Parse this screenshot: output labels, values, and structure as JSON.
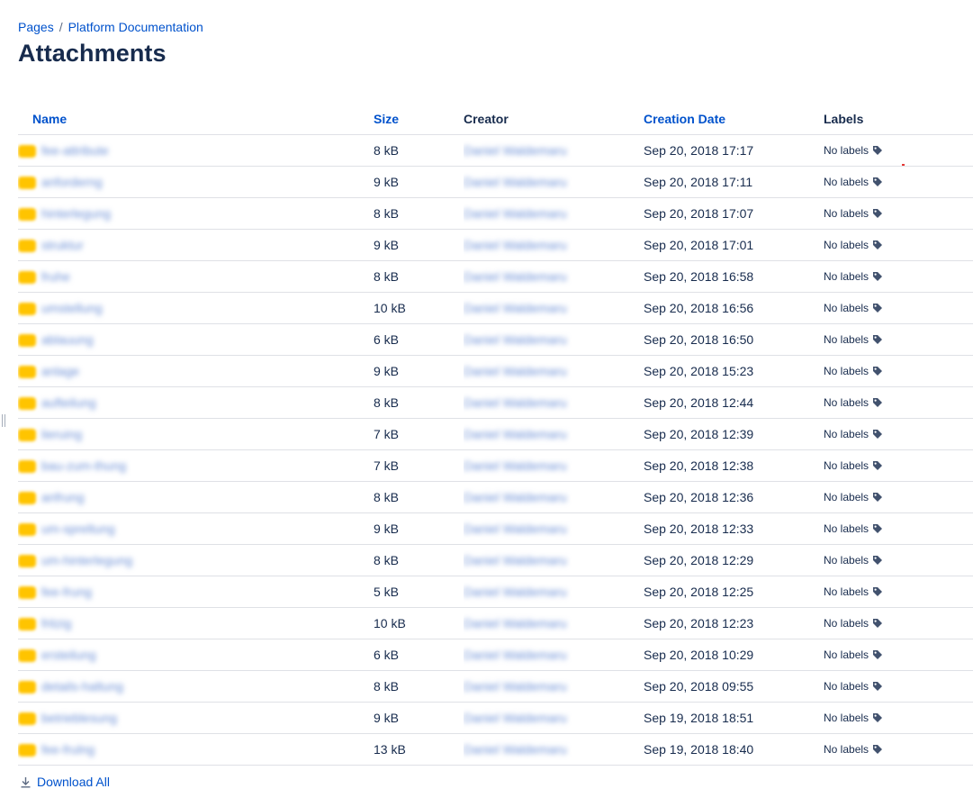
{
  "breadcrumb": {
    "items": [
      "Pages",
      "Platform Documentation"
    ],
    "separator": "/"
  },
  "page_title": "Attachments",
  "table": {
    "columns": {
      "name": "Name",
      "size": "Size",
      "creator": "Creator",
      "creation_date": "Creation Date",
      "labels": "Labels"
    },
    "rows": [
      {
        "name": "fee-attribute",
        "size": "8 kB",
        "creator": "Daniel Waldemaru",
        "date": "Sep 20, 2018 17:17",
        "labels": "No labels"
      },
      {
        "name": "anforderng",
        "size": "9 kB",
        "creator": "Daniel Waldemaru",
        "date": "Sep 20, 2018 17:11",
        "labels": "No labels"
      },
      {
        "name": "hinterlegung",
        "size": "8 kB",
        "creator": "Daniel Waldemaru",
        "date": "Sep 20, 2018 17:07",
        "labels": "No labels"
      },
      {
        "name": "struktur",
        "size": "9 kB",
        "creator": "Daniel Waldemaru",
        "date": "Sep 20, 2018 17:01",
        "labels": "No labels"
      },
      {
        "name": "fruhe",
        "size": "8 kB",
        "creator": "Daniel Waldemaru",
        "date": "Sep 20, 2018 16:58",
        "labels": "No labels"
      },
      {
        "name": "umstellung",
        "size": "10 kB",
        "creator": "Daniel Waldemaru",
        "date": "Sep 20, 2018 16:56",
        "labels": "No labels"
      },
      {
        "name": "ablauung",
        "size": "6 kB",
        "creator": "Daniel Waldemaru",
        "date": "Sep 20, 2018 16:50",
        "labels": "No labels"
      },
      {
        "name": "anlage",
        "size": "9 kB",
        "creator": "Daniel Waldemaru",
        "date": "Sep 20, 2018 15:23",
        "labels": "No labels"
      },
      {
        "name": "aufteilung",
        "size": "8 kB",
        "creator": "Daniel Waldemaru",
        "date": "Sep 20, 2018 12:44",
        "labels": "No labels"
      },
      {
        "name": "lieruing",
        "size": "7 kB",
        "creator": "Daniel Waldemaru",
        "date": "Sep 20, 2018 12:39",
        "labels": "No labels"
      },
      {
        "name": "bau-zum-thung",
        "size": "7 kB",
        "creator": "Daniel Waldemaru",
        "date": "Sep 20, 2018 12:38",
        "labels": "No labels"
      },
      {
        "name": "anfrung",
        "size": "8 kB",
        "creator": "Daniel Waldemaru",
        "date": "Sep 20, 2018 12:36",
        "labels": "No labels"
      },
      {
        "name": "um-spreltung",
        "size": "9 kB",
        "creator": "Daniel Waldemaru",
        "date": "Sep 20, 2018 12:33",
        "labels": "No labels"
      },
      {
        "name": "um-hinterlegung",
        "size": "8 kB",
        "creator": "Daniel Waldemaru",
        "date": "Sep 20, 2018 12:29",
        "labels": "No labels"
      },
      {
        "name": "fee-frung",
        "size": "5 kB",
        "creator": "Daniel Waldemaru",
        "date": "Sep 20, 2018 12:25",
        "labels": "No labels"
      },
      {
        "name": "fritzig",
        "size": "10 kB",
        "creator": "Daniel Waldemaru",
        "date": "Sep 20, 2018 12:23",
        "labels": "No labels"
      },
      {
        "name": "ersteilung",
        "size": "6 kB",
        "creator": "Daniel Waldemaru",
        "date": "Sep 20, 2018 10:29",
        "labels": "No labels"
      },
      {
        "name": "details-haltung",
        "size": "8 kB",
        "creator": "Daniel Waldemaru",
        "date": "Sep 20, 2018 09:55",
        "labels": "No labels"
      },
      {
        "name": "betrieblesung",
        "size": "9 kB",
        "creator": "Daniel Waldemaru",
        "date": "Sep 19, 2018 18:51",
        "labels": "No labels"
      },
      {
        "name": "fee-frulng",
        "size": "13 kB",
        "creator": "Daniel Waldemaru",
        "date": "Sep 19, 2018 18:40",
        "labels": "No labels"
      }
    ]
  },
  "download_all_label": "Download All",
  "colors": {
    "link": "#0052cc",
    "text": "#172b4d",
    "muted": "#5e6c84",
    "divider": "#dfe1e6",
    "file_icon": "#ffc400"
  }
}
